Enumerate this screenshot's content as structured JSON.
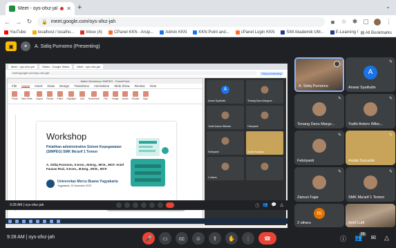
{
  "browser": {
    "tab_title": "Meet - oys-ofxz-jah",
    "url": "meet.google.com/oys-ofxz-jah",
    "bookmarks": [
      "YouTube",
      "localhost / localho...",
      "Inbox (4)",
      "CPanel KKN - Arsip...",
      "Admin KKN",
      "KKN Point and...",
      "cPanel Login KKN",
      "SIM Akademik UM...",
      "E-Learning Univer..."
    ],
    "all_bookmarks": "All Bookmarks"
  },
  "meet": {
    "presenting_label": "A. Sidiq Purnomo (Presenting)",
    "meeting_code": "oys-ofxz-jah",
    "time": "9:28 AM",
    "inner_time": "9:28 AM | oys-ofxz-jah"
  },
  "shared": {
    "inner_tabs": [
      "Meet - oys-ofxz-jah",
      "Slides - Google Slides",
      "Meet - oys-ofxz-jah"
    ],
    "inner_url": "meet.google.com/oys-ofxz-jah",
    "stop_presenting": "Stop presenting",
    "ppt_window_title": "Materi Workshop SIMPEG - PowerPoint",
    "ppt_menu": [
      "File",
      "Home",
      "Insert",
      "Draw",
      "Design",
      "Transitions",
      "Animations",
      "Slide Show",
      "Review",
      "View",
      "Help"
    ],
    "ppt_active_menu": "Home",
    "ribbon": [
      "Paste",
      "New Slide",
      "Layout",
      "Reuse",
      "Editor",
      "Highlight",
      "Add",
      "Bookmark",
      "File",
      "Image",
      "Audio",
      "Dictate",
      "Sign"
    ],
    "slide": {
      "title": "Workshop",
      "subtitle": "Pelatihan administrative Sistem Kepegawaian (SIMPEG) SMK Ma'arif 1 Temon",
      "names": "A. Sidiq Purnomo, S.Kom., M.Eng., MCE., MCF. Anief Fauzan Rozi, S.Kom., M.Eng., MCE., MCF.",
      "university": "Universitas Mercu Buana Yogyakarta",
      "date": "Yogyakarta, 10 November 2023"
    },
    "ppt_status": "Slide 1 of 19",
    "mini_tiles": [
      "Anwar Syaifudin",
      "Tenang Danu Margono",
      "Yudhi Antoro Wibowo",
      "Febriyanti",
      "Fahriyanti",
      "Arafat Suryanto",
      "2 others"
    ],
    "share_popup": "meet.google.com is sharing your screen.",
    "share_stop": "Stop sharing",
    "share_hide": "Hide"
  },
  "participants": [
    {
      "name": "A. Sidiq Purnomo",
      "kind": "photo",
      "active": true
    },
    {
      "name": "Anwar Syaifudin",
      "kind": "avatar",
      "letter": "A",
      "color": "#1a73e8"
    },
    {
      "name": "Tenang Danu Margo...",
      "kind": "photo"
    },
    {
      "name": "Yudhi Antoro Wibo...",
      "kind": "photo"
    },
    {
      "name": "Febriyanti",
      "kind": "photo"
    },
    {
      "name": "Arafat Suryanto",
      "kind": "photo"
    },
    {
      "name": "Zainuri Fajar",
      "kind": "photo"
    },
    {
      "name": "SMK Ma'arif 1 Temon",
      "kind": "photo"
    },
    {
      "name": "2 others",
      "kind": "avatar",
      "letter": "m",
      "color": "#e37400"
    },
    {
      "name": "Arief Lutfi",
      "kind": "cam"
    }
  ],
  "controls": {
    "people_count": "16"
  }
}
